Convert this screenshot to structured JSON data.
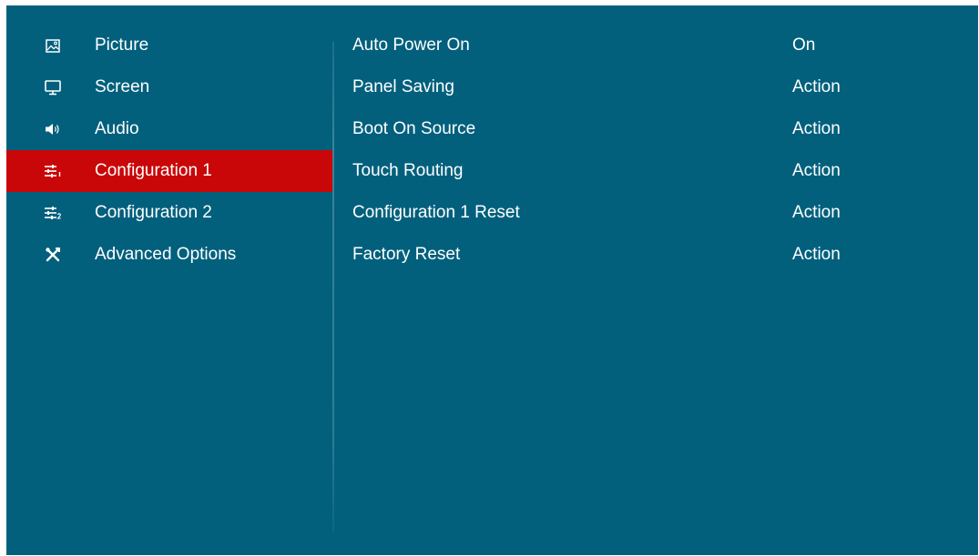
{
  "colors": {
    "background": "#02607d",
    "active_item": "#c90608",
    "text": "#ffffff"
  },
  "sidebar": {
    "items": [
      {
        "label": "Picture",
        "icon": "picture-icon",
        "active": false
      },
      {
        "label": "Screen",
        "icon": "monitor-icon",
        "active": false
      },
      {
        "label": "Audio",
        "icon": "speaker-icon",
        "active": false
      },
      {
        "label": "Configuration 1",
        "icon": "sliders-1-icon",
        "active": true
      },
      {
        "label": "Configuration 2",
        "icon": "sliders-2-icon",
        "active": false
      },
      {
        "label": "Advanced Options",
        "icon": "tools-icon",
        "active": false
      }
    ]
  },
  "settings": {
    "rows": [
      {
        "label": "Auto Power On",
        "value": "On"
      },
      {
        "label": "Panel Saving",
        "value": "Action"
      },
      {
        "label": "Boot On Source",
        "value": "Action"
      },
      {
        "label": "Touch Routing",
        "value": "Action"
      },
      {
        "label": "Configuration 1 Reset",
        "value": "Action"
      },
      {
        "label": "Factory Reset",
        "value": "Action"
      }
    ]
  }
}
